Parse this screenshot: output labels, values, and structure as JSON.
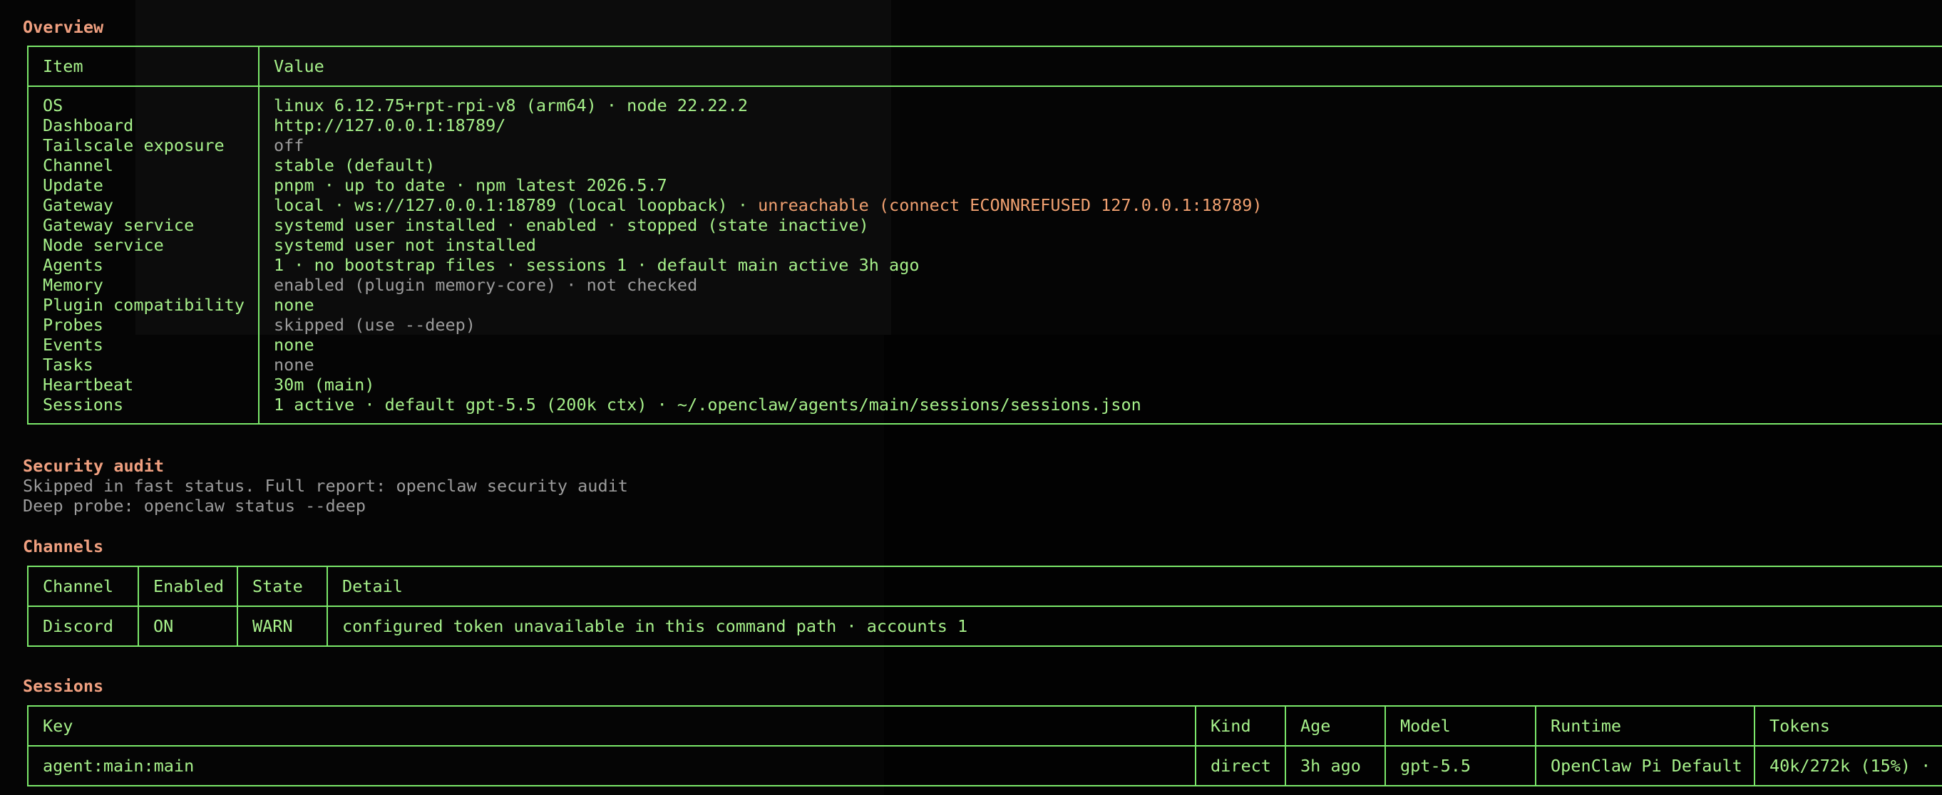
{
  "colors": {
    "background": "#050505",
    "text": "#a6f08a",
    "border": "#7be86a",
    "heading": "#f0a080",
    "dim": "#9c9c9c",
    "warn": "#f0a070"
  },
  "overview": {
    "heading": "Overview",
    "columns": [
      "Item",
      "Value"
    ],
    "rows": [
      {
        "item": "OS",
        "value": "linux 6.12.75+rpt-rpi-v8 (arm64) · node 22.22.2"
      },
      {
        "item": "Dashboard",
        "value": "http://127.0.0.1:18789/"
      },
      {
        "item": "Tailscale exposure",
        "value": "off"
      },
      {
        "item": "Channel",
        "value": "stable (default)"
      },
      {
        "item": "Update",
        "value": "pnpm · up to date · npm latest 2026.5.7"
      },
      {
        "item": "Gateway",
        "value": "local · ws://127.0.0.1:18789 (local loopback) · ",
        "value_warn": "unreachable (connect ECONNREFUSED 127.0.0.1:18789)"
      },
      {
        "item": "Gateway service",
        "value": "systemd user installed · enabled · stopped (state inactive)"
      },
      {
        "item": "Node service",
        "value": "systemd user not installed"
      },
      {
        "item": "Agents",
        "value": "1 · no bootstrap files · sessions 1 · default main active 3h ago"
      },
      {
        "item": "Memory",
        "value": "enabled (plugin memory-core) · not checked"
      },
      {
        "item": "Plugin compatibility",
        "value": "none"
      },
      {
        "item": "Probes",
        "value": "skipped (use --deep)"
      },
      {
        "item": "Events",
        "value": "none"
      },
      {
        "item": "Tasks",
        "value": "none"
      },
      {
        "item": "Heartbeat",
        "value": "30m (main)"
      },
      {
        "item": "Sessions",
        "value": "1 active · default gpt-5.5 (200k ctx) · ~/.openclaw/agents/main/sessions/sessions.json"
      }
    ]
  },
  "security_audit": {
    "heading": "Security audit",
    "line1": "Skipped in fast status. Full report: openclaw security audit",
    "line2": "Deep probe: openclaw status --deep"
  },
  "channels": {
    "heading": "Channels",
    "columns": [
      "Channel",
      "Enabled",
      "State",
      "Detail"
    ],
    "rows": [
      {
        "channel": "Discord",
        "enabled": "ON",
        "state": "WARN",
        "detail": "configured token unavailable in this command path · accounts 1"
      }
    ]
  },
  "sessions": {
    "heading": "Sessions",
    "columns": [
      "Key",
      "Kind",
      "Age",
      "Model",
      "Runtime",
      "Tokens"
    ],
    "rows": [
      {
        "key": "agent:main:main",
        "kind": "direct",
        "age": "3h ago",
        "model": "gpt-5.5",
        "runtime": "OpenClaw Pi Default",
        "tokens": "40k/272k (15%) ·"
      }
    ]
  }
}
